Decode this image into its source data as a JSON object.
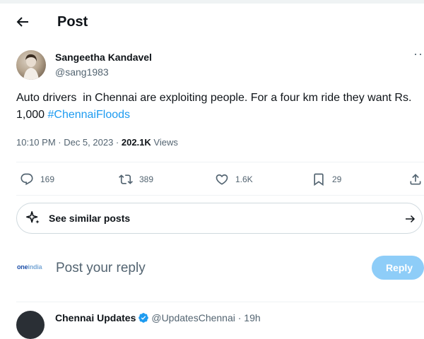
{
  "header": {
    "title": "Post"
  },
  "post": {
    "author_name": "Sangeetha Kandavel",
    "author_handle": "@sang1983",
    "text": "Auto drivers  in Chennai are exploiting people. For a four km ride they want Rs. 1,000 ",
    "hashtag": "#ChennaiFloods",
    "time": "10:10 PM · Dec 5, 2023 · ",
    "views_count": "202.1K",
    "views_label": " Views"
  },
  "actions": {
    "replies": "169",
    "reposts": "389",
    "likes": "1.6K",
    "bookmarks": "29"
  },
  "similar": {
    "label": "See similar posts"
  },
  "reply_box": {
    "logo_text_1": "one",
    "logo_text_2": "india",
    "placeholder": "Post your reply",
    "button_label": "Reply"
  },
  "next_post": {
    "author_name": "Chennai Updates",
    "rest": "@UpdatesChennai · 19h"
  },
  "colors": {
    "accent": "#1d9bf0",
    "reply_button": "#8ecdf8",
    "muted": "#536471"
  }
}
